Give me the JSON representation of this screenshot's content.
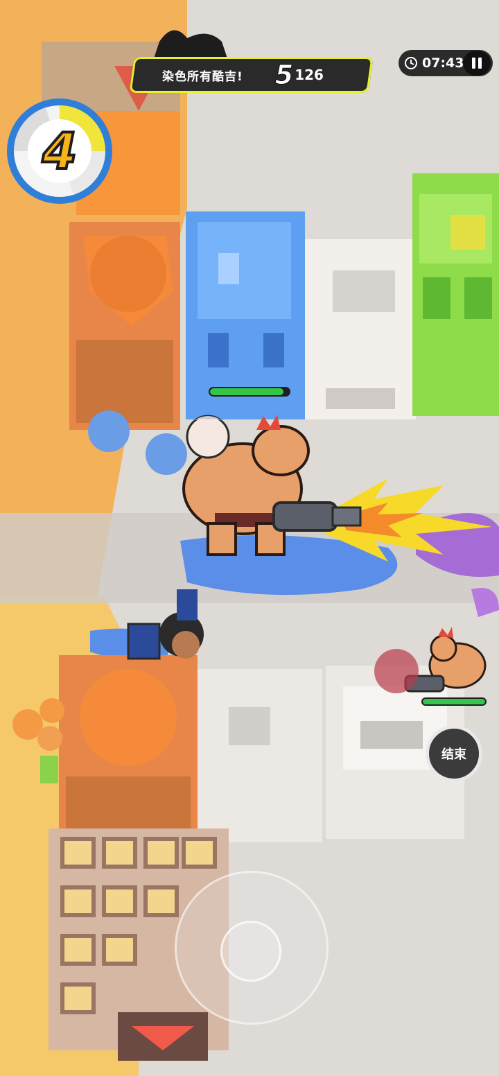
{
  "hud": {
    "mission_text": "染色所有酷吉!",
    "mission_count": "5",
    "mission_total": "126",
    "timer": "07:43",
    "score_number": "4",
    "end_button_label": "结束"
  },
  "player": {
    "health_fraction": 0.93
  },
  "enemy": {
    "health_fraction": 1.0
  },
  "colors": {
    "accent_lime": "#d7ef22",
    "paint_blue": "#5a8ee8",
    "paint_orange": "#f29a3a",
    "paint_green": "#7ed63a",
    "health_green": "#36c548"
  },
  "icons": [
    "clock-icon",
    "pause-icon",
    "joystick",
    "score-wheel"
  ]
}
